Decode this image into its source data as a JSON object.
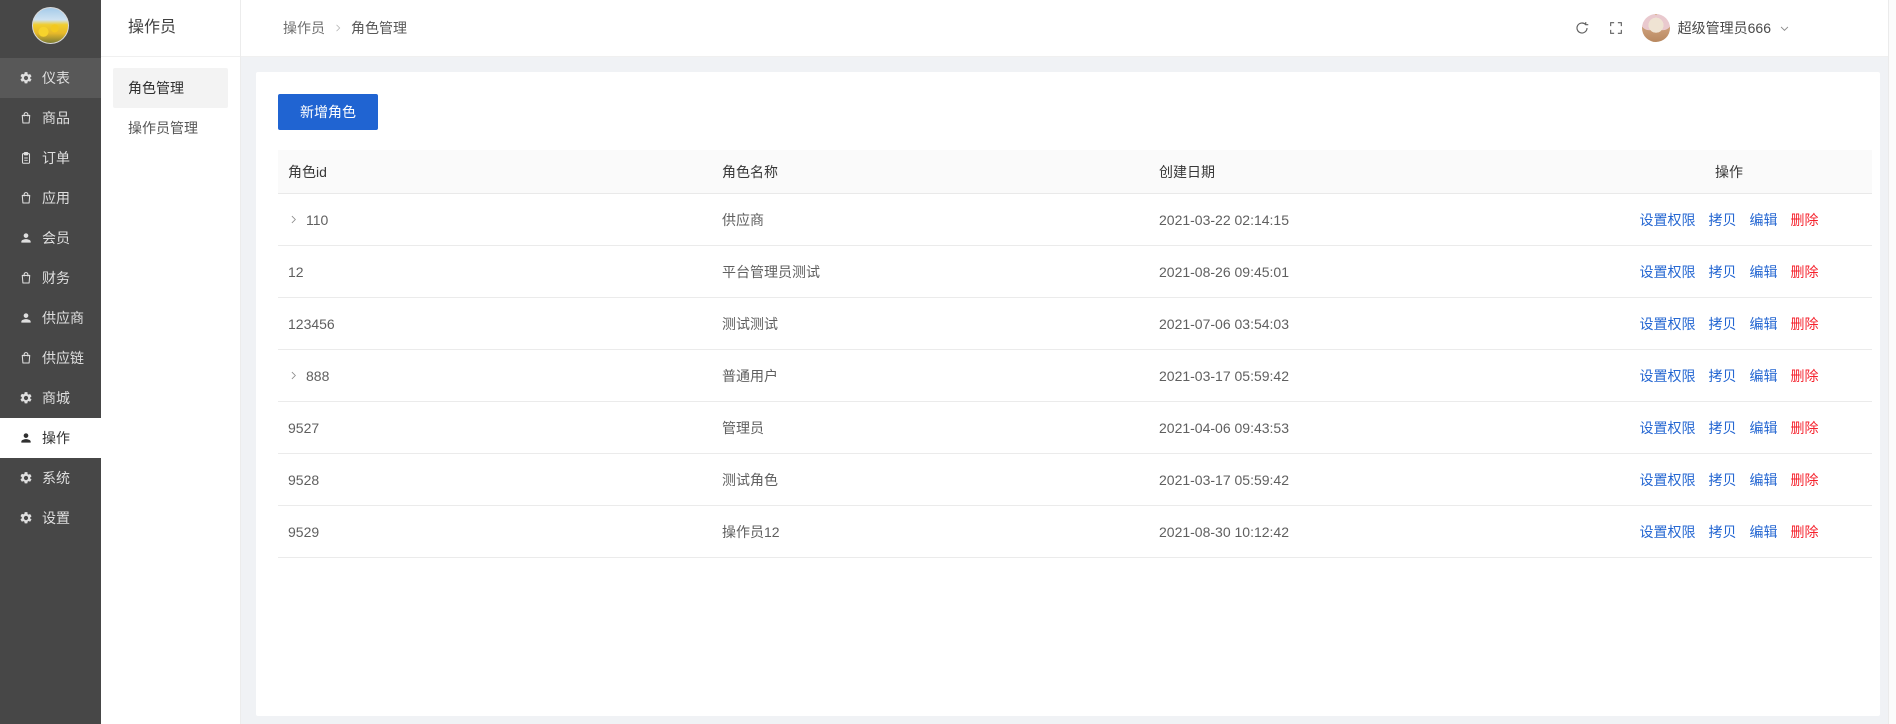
{
  "app": {
    "user_name": "超级管理员666"
  },
  "colors": {
    "sidebar_bg": "#474747",
    "sidebar_highlight": "#585858",
    "primary_blue": "#2064d2",
    "link_blue": "#2567d2",
    "danger_red": "#f5222d",
    "main_bg": "#f0f2f5",
    "table_header_bg": "#fafafa"
  },
  "sidebar": {
    "items": [
      {
        "label": "仪表",
        "icon": "gauge-gear-icon",
        "state": "highlight"
      },
      {
        "label": "商品",
        "icon": "bag-icon",
        "state": ""
      },
      {
        "label": "订单",
        "icon": "clipboard-icon",
        "state": ""
      },
      {
        "label": "应用",
        "icon": "bag-icon",
        "state": ""
      },
      {
        "label": "会员",
        "icon": "person-icon",
        "state": ""
      },
      {
        "label": "财务",
        "icon": "bag-icon",
        "state": ""
      },
      {
        "label": "供应商",
        "icon": "person-icon",
        "state": ""
      },
      {
        "label": "供应链",
        "icon": "bag-icon",
        "state": ""
      },
      {
        "label": "商城",
        "icon": "gear-icon",
        "state": ""
      },
      {
        "label": "操作",
        "icon": "person-icon",
        "state": "active"
      },
      {
        "label": "系统",
        "icon": "gear-icon",
        "state": ""
      },
      {
        "label": "设置",
        "icon": "gear-icon",
        "state": ""
      }
    ]
  },
  "submenu": {
    "title": "操作员",
    "items": [
      {
        "label": "角色管理",
        "active": true
      },
      {
        "label": "操作员管理",
        "active": false
      }
    ]
  },
  "breadcrumb": {
    "items": [
      "操作员",
      "角色管理"
    ]
  },
  "header_icons": [
    "refresh-icon",
    "fullscreen-icon",
    "chevron-down-icon"
  ],
  "toolbar": {
    "add_button": "新增角色"
  },
  "table": {
    "columns": [
      "角色id",
      "角色名称",
      "创建日期",
      "操作"
    ],
    "actions": [
      "设置权限",
      "拷贝",
      "编辑",
      "删除"
    ],
    "rows": [
      {
        "id": "110",
        "expandable": true,
        "name": "供应商",
        "created": "2021-03-22 02:14:15"
      },
      {
        "id": "12",
        "expandable": false,
        "name": "平台管理员测试",
        "created": "2021-08-26 09:45:01"
      },
      {
        "id": "123456",
        "expandable": false,
        "name": "测试测试",
        "created": "2021-07-06 03:54:03"
      },
      {
        "id": "888",
        "expandable": true,
        "name": "普通用户",
        "created": "2021-03-17 05:59:42"
      },
      {
        "id": "9527",
        "expandable": false,
        "name": "管理员",
        "created": "2021-04-06 09:43:53"
      },
      {
        "id": "9528",
        "expandable": false,
        "name": "测试角色",
        "created": "2021-03-17 05:59:42"
      },
      {
        "id": "9529",
        "expandable": false,
        "name": "操作员12",
        "created": "2021-08-30 10:12:42"
      }
    ]
  }
}
